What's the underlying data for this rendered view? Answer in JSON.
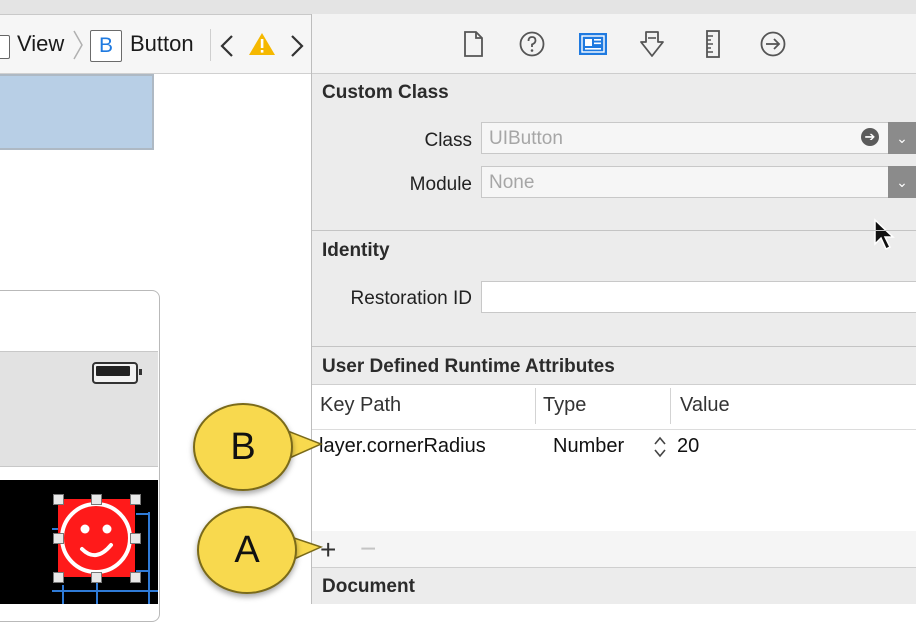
{
  "breadcrumb": {
    "view_label": "View",
    "button_badge": "B",
    "button_label": "Button"
  },
  "inspector": {
    "tabs": [
      "file-inspector-icon",
      "quick-help-icon",
      "identity-inspector-icon",
      "attributes-inspector-icon",
      "size-inspector-icon",
      "connections-inspector-icon"
    ],
    "custom_class": {
      "title": "Custom Class",
      "class_label": "Class",
      "class_placeholder": "UIButton",
      "module_label": "Module",
      "module_placeholder": "None"
    },
    "identity": {
      "title": "Identity",
      "restoration_label": "Restoration ID",
      "restoration_value": ""
    },
    "runtime_attributes": {
      "title": "User Defined Runtime Attributes",
      "columns": [
        "Key Path",
        "Type",
        "Value"
      ],
      "rows": [
        {
          "key_path": "layer.cornerRadius",
          "type": "Number",
          "value": "20"
        }
      ],
      "add": "+",
      "remove": "−"
    },
    "document": {
      "title": "Document"
    }
  },
  "callouts": {
    "a": "A",
    "b": "B"
  },
  "colors": {
    "accent": "#1f7ae0",
    "callout": "#f8d94e",
    "warning": "#f5b800",
    "button_red": "#ff1a1a"
  }
}
